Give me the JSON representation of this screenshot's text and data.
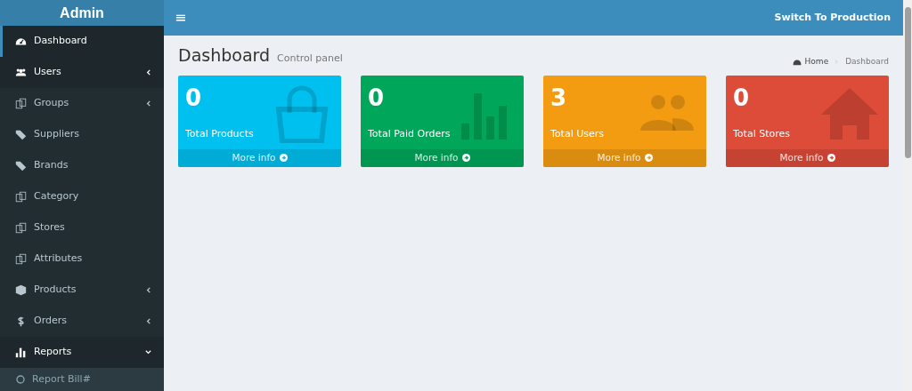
{
  "brand": "Admin",
  "header": {
    "menu_toggle": "≡",
    "action": "Switch To Production"
  },
  "sidebar": {
    "items": [
      {
        "label": "Dashboard",
        "kind": "gauge",
        "selected": true,
        "highlighted": false,
        "submenu": false
      },
      {
        "label": "Users",
        "kind": "users",
        "selected": false,
        "highlighted": true,
        "submenu": true,
        "expanded": false
      },
      {
        "label": "Groups",
        "kind": "copy",
        "selected": false,
        "highlighted": false,
        "submenu": true,
        "expanded": false
      },
      {
        "label": "Suppliers",
        "kind": "tags",
        "selected": false,
        "highlighted": false,
        "submenu": false
      },
      {
        "label": "Brands",
        "kind": "tags",
        "selected": false,
        "highlighted": false,
        "submenu": false
      },
      {
        "label": "Category",
        "kind": "copy",
        "selected": false,
        "highlighted": false,
        "submenu": false
      },
      {
        "label": "Stores",
        "kind": "copy",
        "selected": false,
        "highlighted": false,
        "submenu": false
      },
      {
        "label": "Attributes",
        "kind": "copy",
        "selected": false,
        "highlighted": false,
        "submenu": false
      },
      {
        "label": "Products",
        "kind": "cube",
        "selected": false,
        "highlighted": false,
        "submenu": true,
        "expanded": false
      },
      {
        "label": "Orders",
        "kind": "dollar",
        "selected": false,
        "highlighted": false,
        "submenu": true,
        "expanded": false
      },
      {
        "label": "Reports",
        "kind": "bars",
        "selected": false,
        "highlighted": false,
        "submenu": true,
        "expanded": true,
        "children": [
          {
            "label": "Report Bill#"
          }
        ]
      }
    ]
  },
  "page": {
    "title": "Dashboard",
    "subtitle": "Control panel",
    "breadcrumb": [
      "Home",
      "Dashboard"
    ]
  },
  "cards": [
    {
      "value": "0",
      "label": "Total Products",
      "link": "More info",
      "color": "#00c0ef",
      "kind": "bag"
    },
    {
      "value": "0",
      "label": "Total Paid Orders",
      "link": "More info",
      "color": "#00a65a",
      "kind": "chart"
    },
    {
      "value": "3",
      "label": "Total Users",
      "link": "More info",
      "color": "#f39c12",
      "kind": "people"
    },
    {
      "value": "0",
      "label": "Total Stores",
      "link": "More info",
      "color": "#dd4b39",
      "kind": "home"
    }
  ]
}
